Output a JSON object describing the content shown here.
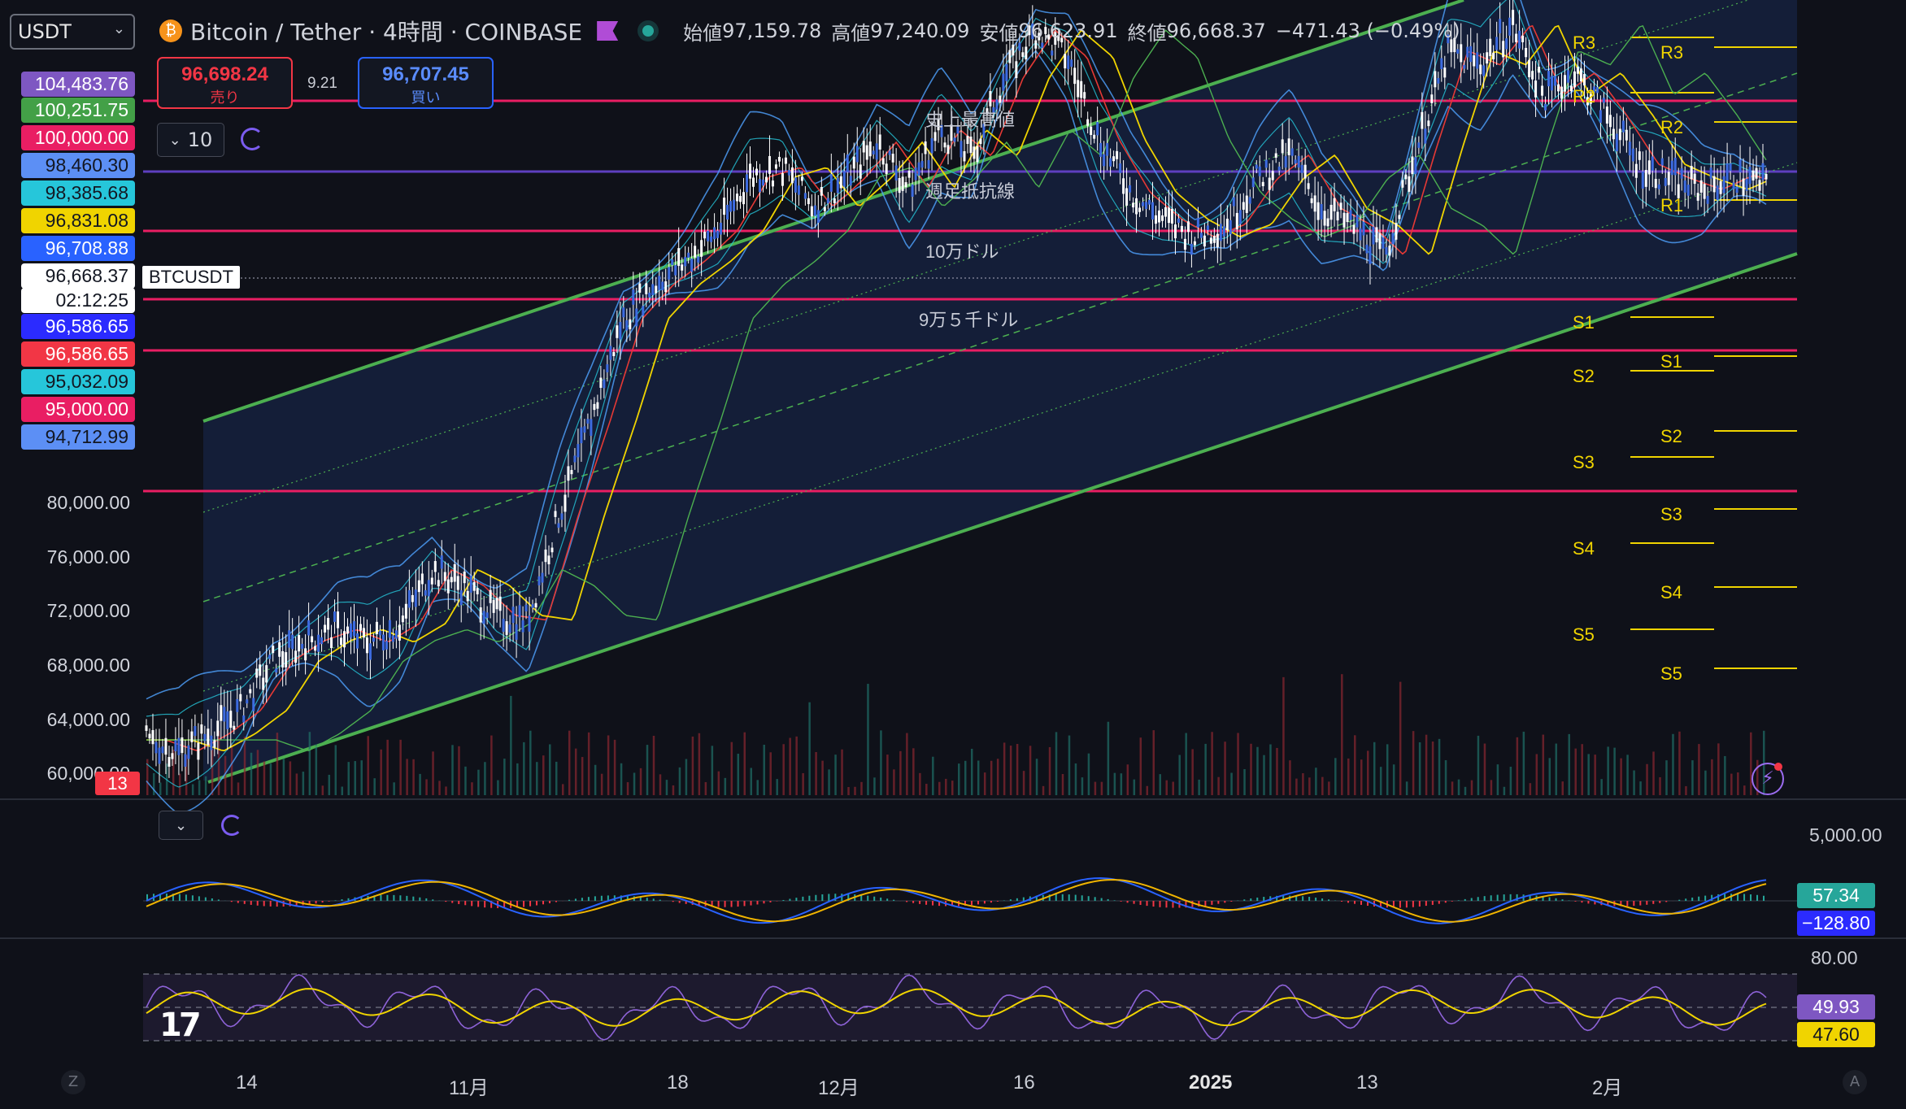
{
  "symbol_select": {
    "value": "USDT"
  },
  "header": {
    "title": "Bitcoin / Tether · 4時間 · COINBASE",
    "o_label": "始値",
    "o": "97,159.78",
    "h_label": "高値",
    "h": "97,240.09",
    "l_label": "安値",
    "l": "96,623.91",
    "c_label": "終値",
    "c": "96,668.37",
    "change": "−471.43 (−0.49%)",
    "colors": {
      "up": "#26a69a",
      "down": "#f23645",
      "text": "#d1d4dc",
      "bg": "#0f1119"
    }
  },
  "trade": {
    "sell_price": "96,698.24",
    "sell_label": "売り",
    "spread": "9.21",
    "buy_price": "96,707.45",
    "buy_label": "買い"
  },
  "indicator_pill": {
    "count": "10"
  },
  "price_boxes": [
    {
      "text": "104,483.76",
      "color": "#7e57c2"
    },
    {
      "text": "100,251.75",
      "color": "#43a047"
    },
    {
      "text": "100,000.00",
      "color": "#e91e63"
    },
    {
      "text": "98,460.30",
      "color": "#5c8ff5"
    },
    {
      "text": "98,385.68",
      "color": "#26c6da"
    },
    {
      "text": "96,831.08",
      "color": "#f0d400"
    },
    {
      "text": "96,708.88",
      "color": "#2962ff"
    },
    {
      "text": "96,668.37",
      "color": "#ffffff"
    },
    {
      "text": "02:12:25",
      "color": "#ffffff"
    },
    {
      "text": "96,586.65",
      "color": "#2b2bff"
    },
    {
      "text": "96,586.65",
      "color": "#f23645"
    },
    {
      "text": "95,032.09",
      "color": "#26c6da"
    },
    {
      "text": "95,000.00",
      "color": "#e91e63"
    },
    {
      "text": "94,712.99",
      "color": "#5c8ff5"
    }
  ],
  "price_ticks": [
    "80,000.00",
    "76,000.00",
    "72,000.00",
    "68,000.00",
    "64,000.00",
    "60,000.00"
  ],
  "symbol_tag": "BTCUSDT",
  "badge_13": "13",
  "annotations": {
    "ath": "史上最高値",
    "weekly": "週足抵抗線",
    "k100": "10万ドル",
    "k95": "9万５千ドル"
  },
  "pivots_left": [
    "R3",
    "R2",
    "S1",
    "S2",
    "S3",
    "S4",
    "S5"
  ],
  "pivots_right": [
    "R3",
    "R2",
    "R1",
    "S1",
    "S2",
    "S3",
    "S4",
    "S5"
  ],
  "macd": {
    "axis": "5,000.00",
    "val1": "57.34",
    "val2": "−128.80"
  },
  "rsi": {
    "axis": "80.00",
    "val1": "49.93",
    "val2": "47.60"
  },
  "x_axis": [
    "14",
    "11月",
    "18",
    "12月",
    "16",
    "2025",
    "13",
    "2月"
  ],
  "corner_left": "Z",
  "corner_right": "A",
  "chart_data": {
    "type": "line",
    "title": "Bitcoin / Tether · 4時間 · COINBASE",
    "series": [
      {
        "name": "BTCUSDT",
        "values": [
          61500,
          60800,
          61900,
          63400,
          66500,
          67800,
          68500,
          67700,
          68900,
          72300,
          71300,
          69400,
          69100,
          75800,
          81800,
          88200,
          90400,
          91900,
          93800,
          97200,
          97800,
          95300,
          97100,
          99400,
          96500,
          100200,
          98500,
          103500,
          106500,
          104800,
          99600,
          96200,
          94500,
          93400,
          94200,
          97100,
          98600,
          95200,
          94100,
          92200,
          99000,
          105200,
          104300,
          106900,
          102400,
          103800,
          101100,
          98000,
          97100,
          96400,
          97300,
          96668
        ]
      }
    ],
    "ylim": [
      58000,
      108000
    ]
  }
}
